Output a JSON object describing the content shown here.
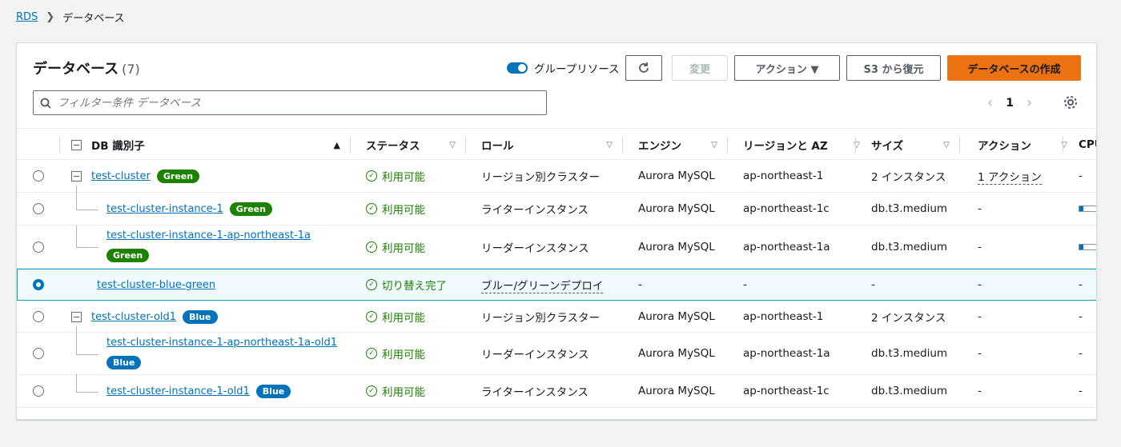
{
  "breadcrumb": {
    "root": "RDS",
    "current": "データベース"
  },
  "panel": {
    "title": "データベース",
    "count": "(7)",
    "group_toggle_label": "グループリソース",
    "buttons": {
      "edit": "変更",
      "actions": "アクション ▼",
      "restore_s3": "S3 から復元",
      "create": "データベースの作成"
    },
    "search_placeholder": "フィルター条件 データベース",
    "pagination": {
      "current_page": "1"
    }
  },
  "columns": {
    "db_id": "DB 識別子",
    "status": "ステータス",
    "role": "ロール",
    "engine": "エンジン",
    "region": "リージョンと AZ",
    "size": "サイズ",
    "actions": "アクション",
    "cpu": "CPU"
  },
  "rows": [
    {
      "id": "test-cluster",
      "badge": "Green",
      "status": "利用可能",
      "role": "リージョン別クラスター",
      "engine": "Aurora MySQL",
      "region": "ap-northeast-1",
      "size": "2 インスタンス",
      "actions": "1 アクション",
      "cpu": "-"
    },
    {
      "id": "test-cluster-instance-1",
      "badge": "Green",
      "status": "利用可能",
      "role": "ライターインスタンス",
      "engine": "Aurora MySQL",
      "region": "ap-northeast-1c",
      "size": "db.t3.medium",
      "actions": "-"
    },
    {
      "id": "test-cluster-instance-1-ap-northeast-1a",
      "badge": "Green",
      "status": "利用可能",
      "role": "リーダーインスタンス",
      "engine": "Aurora MySQL",
      "region": "ap-northeast-1a",
      "size": "db.t3.medium",
      "actions": "-"
    },
    {
      "id": "test-cluster-blue-green",
      "status": "切り替え完了",
      "role": "ブルー/グリーンデプロイ",
      "engine": "-",
      "region": "-",
      "size": "-",
      "actions": "-",
      "cpu": "-"
    },
    {
      "id": "test-cluster-old1",
      "badge": "Blue",
      "status": "利用可能",
      "role": "リージョン別クラスター",
      "engine": "Aurora MySQL",
      "region": "ap-northeast-1",
      "size": "2 インスタンス",
      "actions": "-",
      "cpu": "-"
    },
    {
      "id": "test-cluster-instance-1-ap-northeast-1a-old1",
      "badge": "Blue",
      "status": "利用可能",
      "role": "リーダーインスタンス",
      "engine": "Aurora MySQL",
      "region": "ap-northeast-1a",
      "size": "db.t3.medium",
      "actions": "-",
      "cpu": "-"
    },
    {
      "id": "test-cluster-instance-1-old1",
      "badge": "Blue",
      "status": "利用可能",
      "role": "ライターインスタンス",
      "engine": "Aurora MySQL",
      "region": "ap-northeast-1c",
      "size": "db.t3.medium",
      "actions": "-",
      "cpu": "-"
    }
  ]
}
